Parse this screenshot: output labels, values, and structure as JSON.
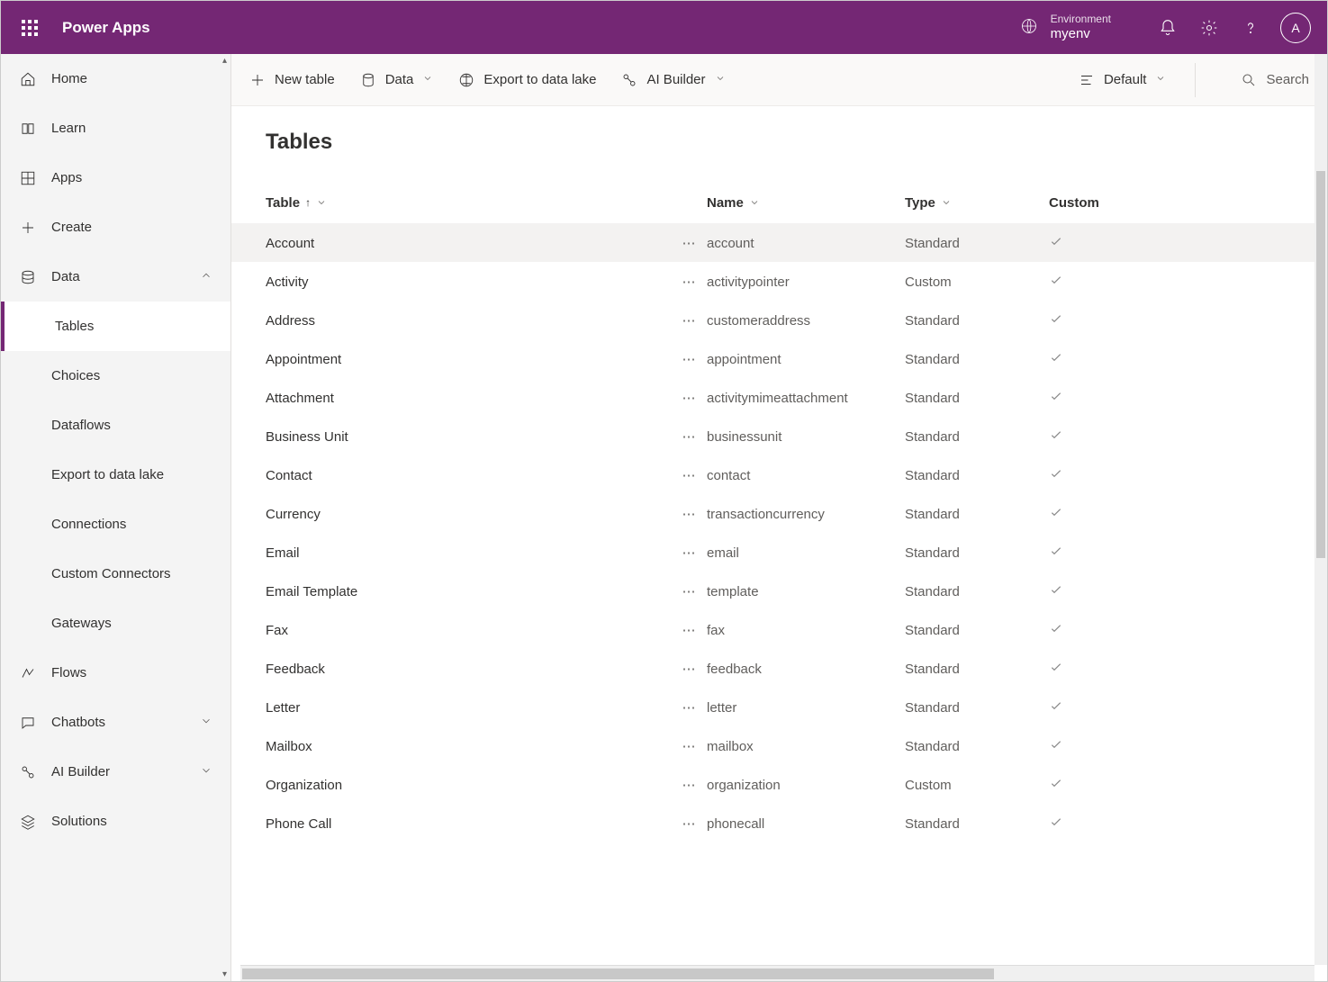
{
  "header": {
    "app_title": "Power Apps",
    "env_label": "Environment",
    "env_name": "myenv",
    "avatar_initial": "A"
  },
  "sidebar": {
    "items": [
      {
        "label": "Home"
      },
      {
        "label": "Learn"
      },
      {
        "label": "Apps"
      },
      {
        "label": "Create"
      },
      {
        "label": "Data",
        "expanded": true
      },
      {
        "label": "Tables",
        "active": true
      },
      {
        "label": "Choices"
      },
      {
        "label": "Dataflows"
      },
      {
        "label": "Export to data lake"
      },
      {
        "label": "Connections"
      },
      {
        "label": "Custom Connectors"
      },
      {
        "label": "Gateways"
      },
      {
        "label": "Flows"
      },
      {
        "label": "Chatbots"
      },
      {
        "label": "AI Builder"
      },
      {
        "label": "Solutions"
      }
    ]
  },
  "toolbar": {
    "new_table": "New table",
    "data": "Data",
    "export": "Export to data lake",
    "ai_builder": "AI Builder",
    "default_view": "Default",
    "search": "Search"
  },
  "page": {
    "title": "Tables",
    "columns": {
      "table": "Table",
      "name": "Name",
      "type": "Type",
      "custom": "Custom"
    },
    "rows": [
      {
        "table": "Account",
        "name": "account",
        "type": "Standard",
        "hl": true
      },
      {
        "table": "Activity",
        "name": "activitypointer",
        "type": "Custom"
      },
      {
        "table": "Address",
        "name": "customeraddress",
        "type": "Standard"
      },
      {
        "table": "Appointment",
        "name": "appointment",
        "type": "Standard"
      },
      {
        "table": "Attachment",
        "name": "activitymimeattachment",
        "type": "Standard"
      },
      {
        "table": "Business Unit",
        "name": "businessunit",
        "type": "Standard"
      },
      {
        "table": "Contact",
        "name": "contact",
        "type": "Standard"
      },
      {
        "table": "Currency",
        "name": "transactioncurrency",
        "type": "Standard"
      },
      {
        "table": "Email",
        "name": "email",
        "type": "Standard"
      },
      {
        "table": "Email Template",
        "name": "template",
        "type": "Standard"
      },
      {
        "table": "Fax",
        "name": "fax",
        "type": "Standard"
      },
      {
        "table": "Feedback",
        "name": "feedback",
        "type": "Standard"
      },
      {
        "table": "Letter",
        "name": "letter",
        "type": "Standard"
      },
      {
        "table": "Mailbox",
        "name": "mailbox",
        "type": "Standard"
      },
      {
        "table": "Organization",
        "name": "organization",
        "type": "Custom"
      },
      {
        "table": "Phone Call",
        "name": "phonecall",
        "type": "Standard"
      }
    ]
  }
}
